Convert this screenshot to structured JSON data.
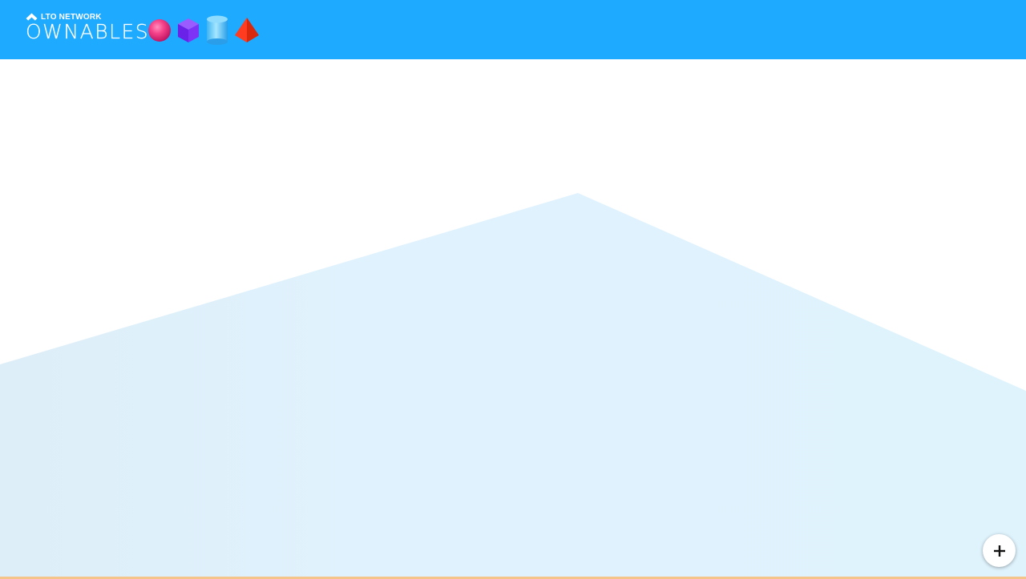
{
  "header": {
    "brand_network": "LTO NETWORK",
    "brand_name": "OWNABLES",
    "background_color": "#1eaaff"
  },
  "brand_shapes": [
    "sphere-icon",
    "cube-icon",
    "cylinder-icon",
    "pyramid-icon"
  ],
  "scene": {
    "background_color": "#ffffff",
    "plane_color": "#dff3fd"
  },
  "fab": {
    "icon": "plus-icon"
  }
}
